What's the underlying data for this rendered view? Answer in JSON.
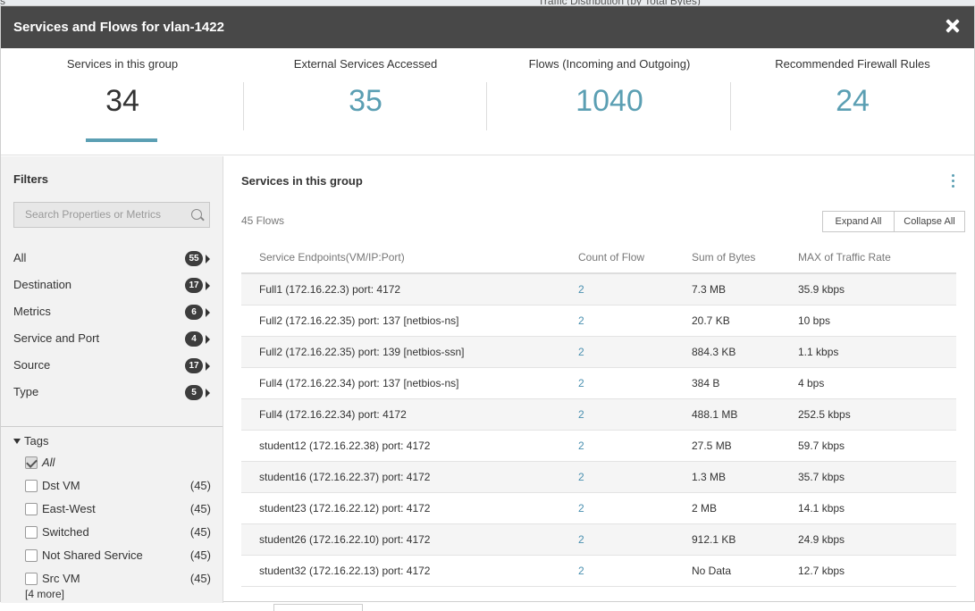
{
  "backdrop": {
    "left_text": "s",
    "right_text": "Traffic Distribution (by Total Bytes)"
  },
  "modal": {
    "title": "Services and Flows for vlan-1422"
  },
  "summary": [
    {
      "label": "Services in this group",
      "value": "34",
      "active": true
    },
    {
      "label": "External Services Accessed",
      "value": "35"
    },
    {
      "label": "Flows (Incoming and Outgoing)",
      "value": "1040"
    },
    {
      "label": "Recommended Firewall Rules",
      "value": "24"
    }
  ],
  "filters": {
    "title": "Filters",
    "search_placeholder": "Search Properties or Metrics",
    "items": [
      {
        "label": "All",
        "count": "55"
      },
      {
        "label": "Destination",
        "count": "17"
      },
      {
        "label": "Metrics",
        "count": "6"
      },
      {
        "label": "Service and Port",
        "count": "4"
      },
      {
        "label": "Source",
        "count": "17"
      },
      {
        "label": "Type",
        "count": "5"
      }
    ],
    "tags": {
      "title": "Tags",
      "items": [
        {
          "label": "All",
          "count": "",
          "checked": true
        },
        {
          "label": "Dst VM",
          "count": "(45)",
          "checked": false
        },
        {
          "label": "East-West",
          "count": "(45)",
          "checked": false
        },
        {
          "label": "Switched",
          "count": "(45)",
          "checked": false
        },
        {
          "label": "Not Shared Service",
          "count": "(45)",
          "checked": false
        },
        {
          "label": "Src VM",
          "count": "(45)",
          "checked": false
        }
      ],
      "more": "[4 more]"
    }
  },
  "main": {
    "title": "Services in this group",
    "flows_count": "45 Flows",
    "expand_label": "Expand All",
    "collapse_label": "Collapse All",
    "columns": [
      "Service Endpoints(VM/IP:Port)",
      "Count of Flow",
      "Sum of Bytes",
      "MAX of Traffic Rate"
    ],
    "rows": [
      [
        "Full1 (172.16.22.3) port: 4172",
        "2",
        "7.3 MB",
        "35.9 kbps"
      ],
      [
        "Full2 (172.16.22.35) port: 137 [netbios-ns]",
        "2",
        "20.7 KB",
        "10 bps"
      ],
      [
        "Full2 (172.16.22.35) port: 139 [netbios-ssn]",
        "2",
        "884.3 KB",
        "1.1 kbps"
      ],
      [
        "Full4 (172.16.22.34) port: 137 [netbios-ns]",
        "2",
        "384 B",
        "4 bps"
      ],
      [
        "Full4 (172.16.22.34) port: 4172",
        "2",
        "488.1 MB",
        "252.5 kbps"
      ],
      [
        "student12 (172.16.22.38) port: 4172",
        "2",
        "27.5 MB",
        "59.7 kbps"
      ],
      [
        "student16 (172.16.22.37) port: 4172",
        "2",
        "1.3 MB",
        "35.7 kbps"
      ],
      [
        "student23 (172.16.22.12) port: 4172",
        "2",
        "2 MB",
        "14.1 kbps"
      ],
      [
        "student26 (172.16.22.10) port: 4172",
        "2",
        "912.1 KB",
        "24.9 kbps"
      ],
      [
        "student32 (172.16.22.13) port: 4172",
        "2",
        "No Data",
        "12.7 kbps"
      ]
    ]
  },
  "colors": {
    "accent": "#5b9fb3",
    "header_bg": "#484848",
    "sidebar_bg": "#f2f2f2"
  }
}
